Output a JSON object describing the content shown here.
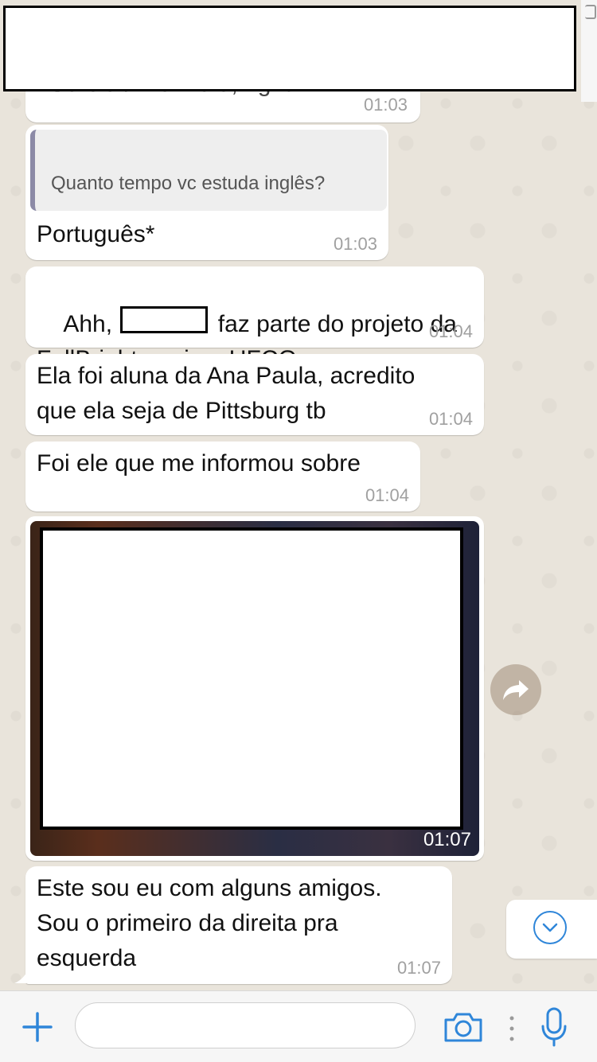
{
  "messages": [
    {
      "id": "m0",
      "text": "Sereia / Mermaid, right?",
      "time": "01:03"
    },
    {
      "id": "m1",
      "quoted_text": "Quanto tempo vc estuda inglês?",
      "text": "Português*",
      "time": "01:03"
    },
    {
      "id": "m2",
      "text_before": "Ahh, ",
      "text_after": " faz parte do projeto da",
      "text_line2": "FullBright aqui na UFCG",
      "time": "01:04"
    },
    {
      "id": "m3",
      "text": "Ela foi aluna da Ana Paula, acredito\nque ela seja de Pittsburg tb",
      "time": "01:04"
    },
    {
      "id": "m4",
      "text": "Foi ele que me informou sobre",
      "time": "01:04"
    },
    {
      "id": "m5",
      "type": "image",
      "time": "01:07"
    },
    {
      "id": "m6",
      "text": "Este sou eu com alguns amigos.\nSou o primeiro da direita pra\nesquerda",
      "time": "01:07"
    }
  ],
  "composer": {
    "placeholder": ""
  },
  "colors": {
    "accent": "#2f86d9",
    "chat_background": "#e9e4db",
    "bubble": "#ffffff",
    "timestamp": "#a0a0a0"
  },
  "icons": {
    "attach": "plus-icon",
    "camera": "camera-icon",
    "microphone": "microphone-icon",
    "forward": "forward-icon",
    "scroll_down": "chevron-down-icon"
  }
}
